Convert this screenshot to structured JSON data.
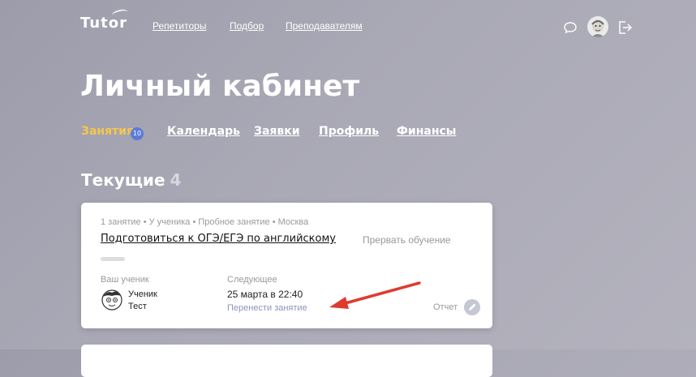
{
  "header": {
    "logo": "Tutor",
    "nav": [
      "Репетиторы",
      "Подбор",
      "Преподавателям"
    ],
    "icons": {
      "chat": "chat-bubble-icon",
      "avatar": "user-avatar",
      "logout": "logout-icon"
    }
  },
  "page_title": "Личный кабинет",
  "tabs": {
    "items": [
      {
        "label": "Занятия",
        "badge": "10",
        "active": true
      },
      {
        "label": "Календарь"
      },
      {
        "label": "Заявки"
      },
      {
        "label": "Профиль"
      },
      {
        "label": "Финансы"
      }
    ]
  },
  "section": {
    "title": "Текущие",
    "count": "4"
  },
  "card": {
    "meta": "1 занятие • У ученика • Пробное занятие • Москва",
    "title": "Подготовиться к ОГЭ/ЕГЭ по английскому",
    "stop_link": "Прервать обучение",
    "student_label": "Ваш ученик",
    "student_first": "Ученик",
    "student_last": "Тест",
    "next_label": "Следующее",
    "next_date": "25 марта в 22:40",
    "reschedule": "Перенести занятие",
    "report": "Отчет"
  },
  "colors": {
    "active_tab": "#f6c84c",
    "badge": "#5b7bd5",
    "annotation_arrow": "#e03a2f"
  }
}
